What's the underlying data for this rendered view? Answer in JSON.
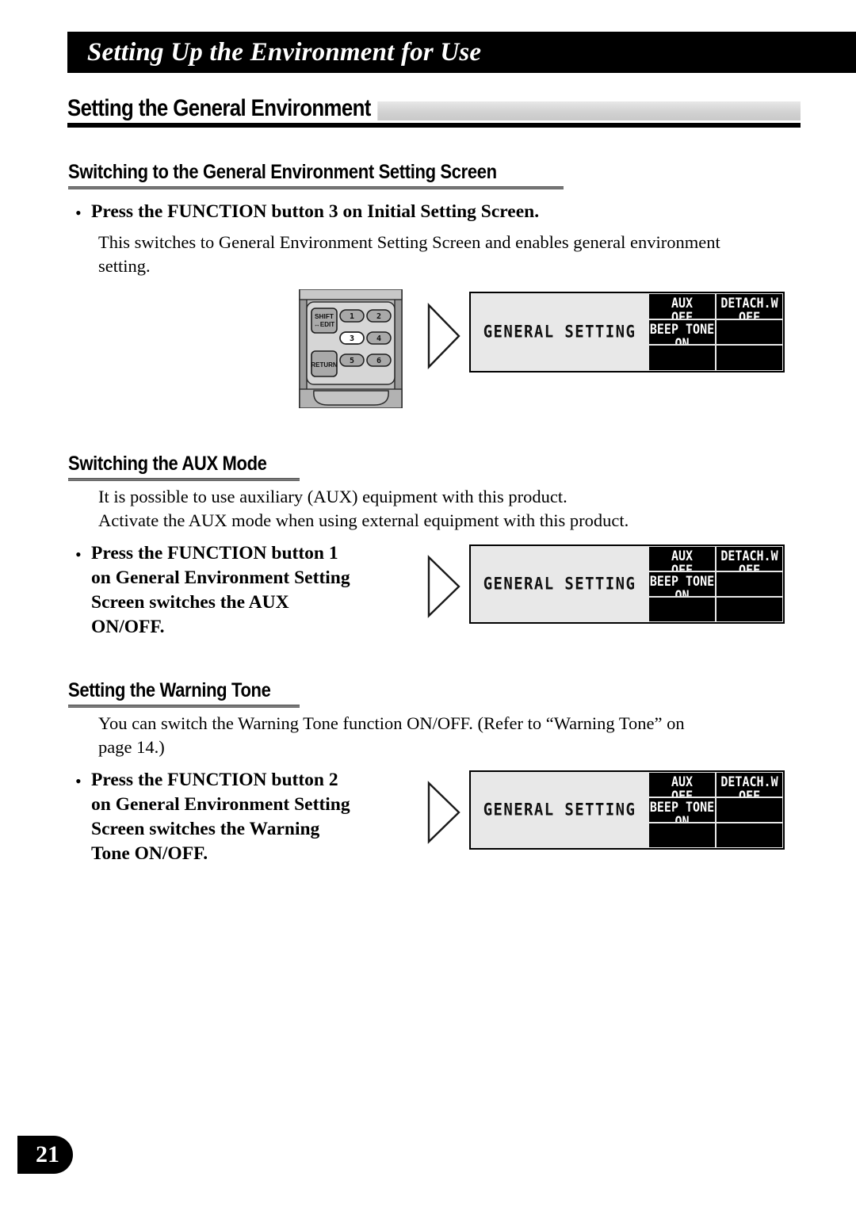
{
  "page": {
    "running_head": "Setting Up the Environment for Use",
    "page_number": "21"
  },
  "section": {
    "h1": "Setting the General Environment"
  },
  "subsections": [
    {
      "heading": "Switching to the General Environment Setting Screen",
      "bullet": "Press the FUNCTION button 3 on Initial Setting Screen.",
      "body": "This switches to General Environment Setting Screen and enables general environment\nsetting."
    },
    {
      "heading": "Switching the AUX Mode",
      "body": "It is possible to use auxiliary (AUX) equipment with this product.\nActivate the AUX mode when using external equipment with this product.",
      "bullet": "Press the FUNCTION button 1\non General Environment Setting\nScreen switches the AUX\nON/OFF."
    },
    {
      "heading": "Setting the Warning Tone",
      "body": "You can switch the Warning Tone function ON/OFF. (Refer to “Warning Tone” on\npage 14.)",
      "bullet": "Press the FUNCTION button 2\non General Environment Setting\nScreen switches the Warning\nTone ON/OFF."
    }
  ],
  "bullet_marker": "•",
  "lcd": {
    "title": "GENERAL SETTING",
    "cells": [
      {
        "label": "AUX",
        "value": "OFF"
      },
      {
        "label": "DETACH.W",
        "value": "OFF"
      },
      {
        "label": "BEEP TONE",
        "value": "ON"
      },
      {
        "label": "",
        "value": ""
      },
      {
        "label": "",
        "value": ""
      },
      {
        "label": "",
        "value": ""
      }
    ]
  },
  "remote": {
    "shift_label": "SHIFT\n↔EDIT",
    "return_label": "RETURN",
    "numbers": [
      "1",
      "2",
      "3",
      "4",
      "5",
      "6"
    ],
    "highlighted_number": "3"
  },
  "colors": {
    "bar_black": "#000000",
    "band_grey": "#d2d2d2",
    "lcd_bg": "#e8e8e8",
    "lcd_cell": "#000000",
    "remote_body": "#a8a8a8",
    "remote_face": "#d0d0d0"
  }
}
